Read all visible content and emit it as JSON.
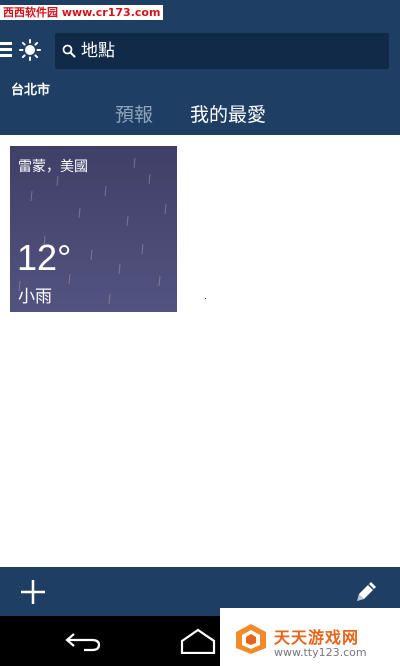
{
  "watermark_top": "西西软件园 www.cr173.com",
  "header": {
    "search_placeholder": "地點",
    "current_city": "台北市",
    "tabs": [
      {
        "label": "預報",
        "active": false
      },
      {
        "label": "我的最愛",
        "active": true
      }
    ],
    "icons": [
      "menu-icon",
      "sun-icon",
      "search-icon"
    ]
  },
  "favorites": [
    {
      "location": "雷蒙，美國",
      "temperature": "12°",
      "condition": "小雨"
    }
  ],
  "bottom_bar": {
    "icons": [
      "plus-icon",
      "pencil-icon"
    ]
  },
  "nav_bar": {
    "icons": [
      "back-icon",
      "home-icon"
    ]
  },
  "watermark_bottom": {
    "title": "天天游戏网",
    "url": "www.tty123.com"
  },
  "colors": {
    "header_bg": "#1e3f63",
    "search_bg": "#102a47",
    "inactive_tab": "#8da3bb",
    "card_bg": "#4a4a74",
    "watermark_red": "#d4141d",
    "watermark_orange": "#e8641b"
  }
}
